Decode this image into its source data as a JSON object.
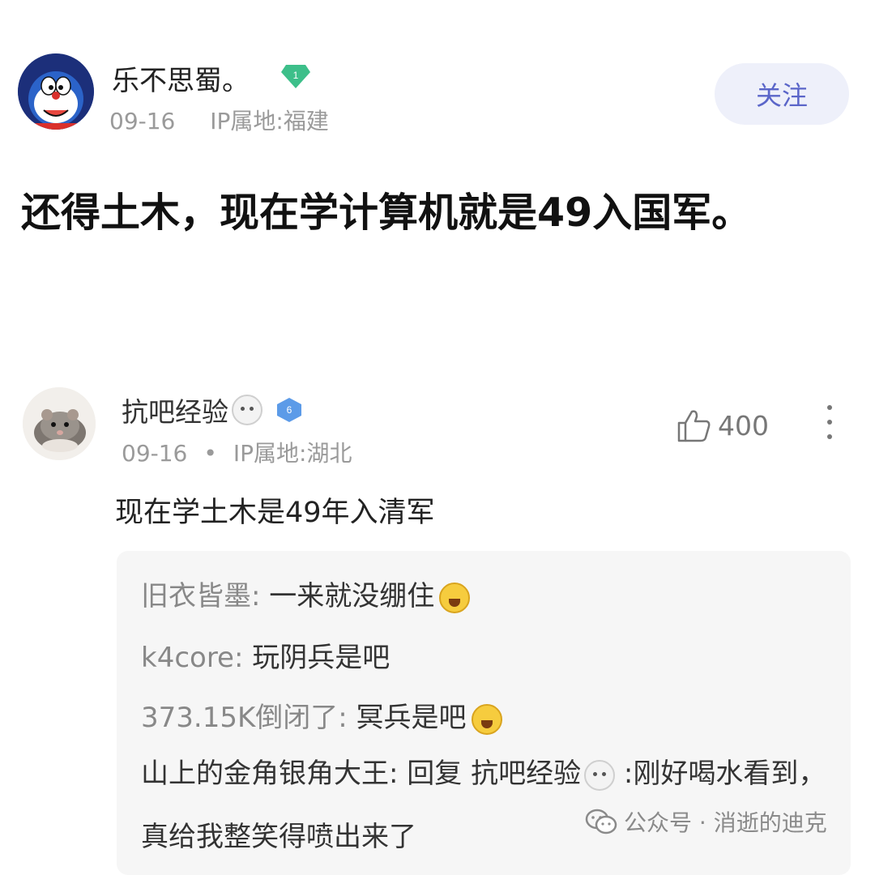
{
  "post": {
    "author": "乐不思蜀。",
    "level": "1",
    "date": "09-16",
    "ip": "IP属地:福建",
    "follow_label": "关注",
    "text": "还得土木，现在学计算机就是49入国军。"
  },
  "comment": {
    "author": "抗吧经验",
    "level": "6",
    "date": "09-16",
    "separator": "•",
    "ip": "IP属地:湖北",
    "likes": "400",
    "text": "现在学土木是49年入清军"
  },
  "replies": [
    {
      "user": "旧衣皆墨:",
      "text": " 一来就没绷住",
      "emoji": "laugh-cry-icon"
    },
    {
      "user": "k4core:",
      "text": " 玩阴兵是吧",
      "emoji": ""
    },
    {
      "user": "373.15K倒闭了:",
      "text": " 冥兵是吧",
      "emoji": "laugh-cry-icon"
    },
    {
      "user": "山上的金角银角大王:",
      "text_before": " 回复 抗吧经验",
      "text_after": " :刚好喝水看到，真给我整笑得喷出来了"
    }
  ],
  "watermark": {
    "text": "公众号 · 消逝的迪克"
  },
  "colors": {
    "follow_bg": "#eef0fa",
    "follow_text": "#5b66c9",
    "level1_badge": "#3dbf8a",
    "level6_badge": "#5c9be8",
    "reply_bg": "#f6f6f6"
  }
}
